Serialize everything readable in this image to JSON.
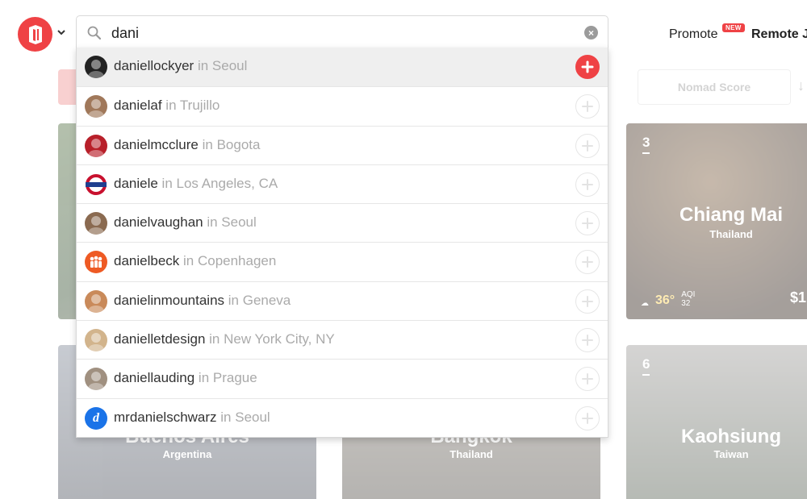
{
  "header": {
    "promote_label": "Promote",
    "new_badge": "NEW",
    "remote_label": "Remote J"
  },
  "search": {
    "value": "dani",
    "placeholder": ""
  },
  "background": {
    "sort_label": "Nomad Score",
    "cards": [
      {
        "rank": "",
        "city": "",
        "country": "",
        "cost": ""
      },
      {
        "rank": "3",
        "city": "Chiang Mai",
        "country": "Thailand",
        "temp": "36°",
        "aqi_label": "AQI",
        "aqi": "32",
        "cost": "$1"
      },
      {
        "rank": "",
        "city": "Buenos Aires",
        "country": "Argentina",
        "cost": ""
      },
      {
        "rank": "",
        "city": "Bangkok",
        "country": "Thailand",
        "cost": ""
      },
      {
        "rank": "6",
        "city": "Kaohsiung",
        "country": "Taiwan",
        "cost": ""
      }
    ]
  },
  "results": [
    {
      "username": "daniellockyer",
      "location": "in Seoul",
      "avatar_color": "#222222",
      "avatar": "photo-dark"
    },
    {
      "username": "danielaf",
      "location": "in Trujillo",
      "avatar_color": "#a0785a",
      "avatar": "photo"
    },
    {
      "username": "danielmcclure",
      "location": "in Bogota",
      "avatar_color": "#b8202a",
      "avatar": "photo"
    },
    {
      "username": "daniele",
      "location": "in Los Angeles, CA",
      "avatar_color": "#c8102e",
      "avatar": "roundel"
    },
    {
      "username": "danielvaughan",
      "location": "in Seoul",
      "avatar_color": "#8a6a50",
      "avatar": "photo"
    },
    {
      "username": "danielbeck",
      "location": "in Copenhagen",
      "avatar_color": "#ee5a24",
      "avatar": "people-logo"
    },
    {
      "username": "danielinmountains",
      "location": "in Geneva",
      "avatar_color": "#c98a5a",
      "avatar": "photo"
    },
    {
      "username": "danielletdesign",
      "location": "in New York City, NY",
      "avatar_color": "#d2b48c",
      "avatar": "photo"
    },
    {
      "username": "daniellauding",
      "location": "in Prague",
      "avatar_color": "#a09080",
      "avatar": "photo"
    },
    {
      "username": "mrdanielschwarz",
      "location": "in Seoul",
      "avatar_color": "#1a73e8",
      "avatar": "letter-d"
    }
  ],
  "colors": {
    "brand": "#ef4245",
    "active_row": "#efefef"
  },
  "icons": {
    "logo": "nomadlist-logo-icon",
    "chevron": "chevron-down-icon",
    "search": "search-icon",
    "clear": "clear-icon",
    "add": "plus-circle-icon"
  }
}
